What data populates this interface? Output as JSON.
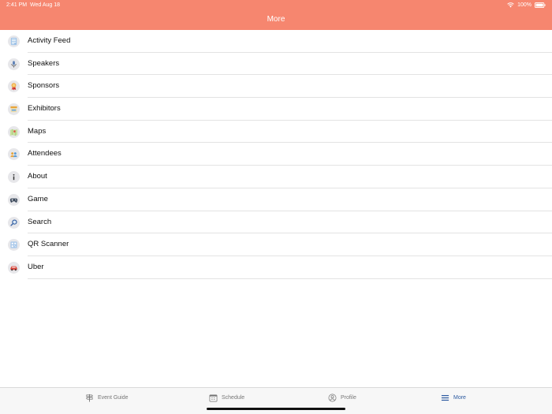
{
  "status_bar": {
    "time": "2:41 PM",
    "date": "Wed Aug 18",
    "battery": "100%"
  },
  "header": {
    "title": "More"
  },
  "menu": {
    "items": [
      {
        "label": "Activity Feed",
        "icon": "activity-feed-icon"
      },
      {
        "label": "Speakers",
        "icon": "microphone-icon"
      },
      {
        "label": "Sponsors",
        "icon": "ribbon-icon"
      },
      {
        "label": "Exhibitors",
        "icon": "booth-icon"
      },
      {
        "label": "Maps",
        "icon": "map-icon"
      },
      {
        "label": "Attendees",
        "icon": "people-icon"
      },
      {
        "label": "About",
        "icon": "info-icon"
      },
      {
        "label": "Game",
        "icon": "gamepad-icon"
      },
      {
        "label": "Search",
        "icon": "magnifier-icon"
      },
      {
        "label": "QR Scanner",
        "icon": "qr-scanner-icon"
      },
      {
        "label": "Uber",
        "icon": "car-icon"
      }
    ]
  },
  "tabbar": {
    "tabs": [
      {
        "label": "Event Guide",
        "icon": "signpost-icon",
        "active": false
      },
      {
        "label": "Schedule",
        "icon": "calendar-icon",
        "active": false
      },
      {
        "label": "Profile",
        "icon": "profile-icon",
        "active": false
      },
      {
        "label": "More",
        "icon": "hamburger-icon",
        "active": true
      }
    ]
  },
  "colors": {
    "header": "#f6866f",
    "active_tab": "#2c5aa0",
    "inactive_tab": "#777777",
    "divider": "#e3e3e3"
  }
}
